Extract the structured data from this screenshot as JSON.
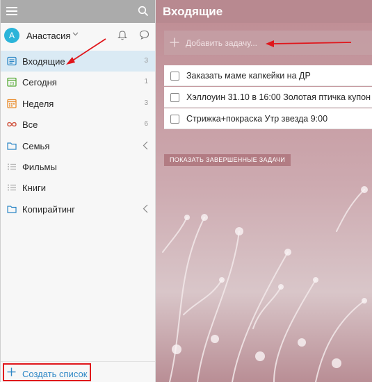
{
  "sidebar": {
    "user": {
      "initial": "А",
      "name": "Анастасия"
    },
    "items": [
      {
        "label": "Входящие",
        "count": "3",
        "icon": "inbox-icon"
      },
      {
        "label": "Сегодня",
        "count": "1",
        "icon": "calendar-today-icon"
      },
      {
        "label": "Неделя",
        "count": "3",
        "icon": "calendar-week-icon"
      },
      {
        "label": "Все",
        "count": "6",
        "icon": "infinity-icon"
      },
      {
        "label": "Семья",
        "count": "",
        "icon": "folder-icon"
      },
      {
        "label": "Фильмы",
        "count": "",
        "icon": "list-icon"
      },
      {
        "label": "Книги",
        "count": "",
        "icon": "list-icon"
      },
      {
        "label": "Копирайтинг",
        "count": "",
        "icon": "folder-icon"
      }
    ],
    "create_label": "Создать список"
  },
  "main": {
    "title": "Входящие",
    "add_placeholder": "Добавить задачу...",
    "tasks": [
      "Заказать маме капкейки на ДР",
      "Хэллоуин 31.10 в 16:00 Золотая птичка купон",
      "Стрижка+покраска Утр звезда 9:00"
    ],
    "show_completed_label": "ПОКАЗАТЬ ЗАВЕРШЕННЫЕ ЗАДАЧИ"
  },
  "colors": {
    "accent": "#2d87c6",
    "annotation_red": "#e0161b",
    "header_bg": "#b88990",
    "active_item_bg": "#daeaf4"
  }
}
